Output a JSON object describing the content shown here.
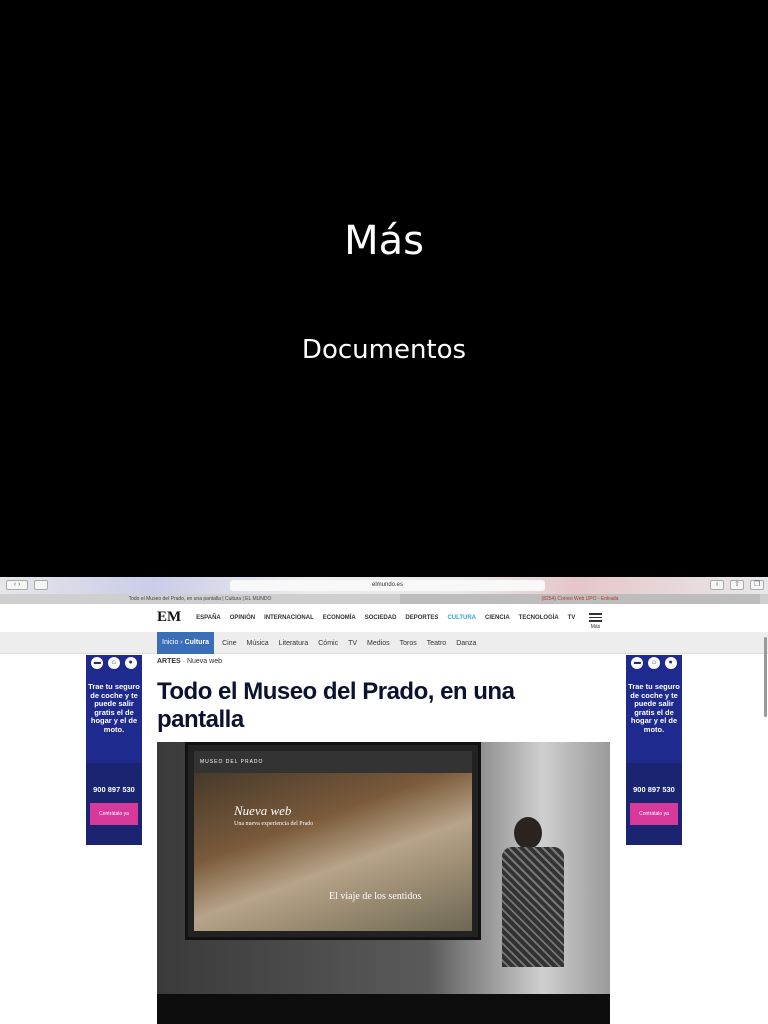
{
  "slide": {
    "title": "Más",
    "subtitle": "Documentos"
  },
  "browser": {
    "url": "elmundo.es",
    "tabs": [
      "Todo el Museo del Prado, en una pantalla | Cultura | EL MUNDO",
      "(8254) Correo Web UPO - Entrada"
    ]
  },
  "site": {
    "logo": "EM",
    "nav": [
      "ESPAÑA",
      "OPINIÓN",
      "INTERNACIONAL",
      "ECONOMÍA",
      "SOCIEDAD",
      "DEPORTES",
      "CULTURA",
      "CIENCIA",
      "TECNOLOGÍA",
      "TV"
    ],
    "menu_label": "Más",
    "accent": "#3a6fb8",
    "breadcrumb": {
      "home": "Inicio",
      "section": "Cultura"
    },
    "subnav": [
      "Cine",
      "Música",
      "Literatura",
      "Cómic",
      "TV",
      "Medios",
      "Toros",
      "Teatro",
      "Danza"
    ]
  },
  "article": {
    "kicker": "ARTES",
    "kicker_sub": "· Nueva web",
    "headline": "Todo el Museo del Prado, en una pantalla",
    "photo": {
      "site_name": "MUSEO DEL PRADO",
      "tagline": "Nueva web",
      "subtag": "Una nueva experiencia del Prado",
      "promo": "El viaje de los sentidos"
    }
  },
  "ad": {
    "text": "Trae tu seguro de coche y te puede salir gratis el de hogar y el de moto.",
    "phone": "900 897 530",
    "cta": "Contrátalo ya"
  }
}
